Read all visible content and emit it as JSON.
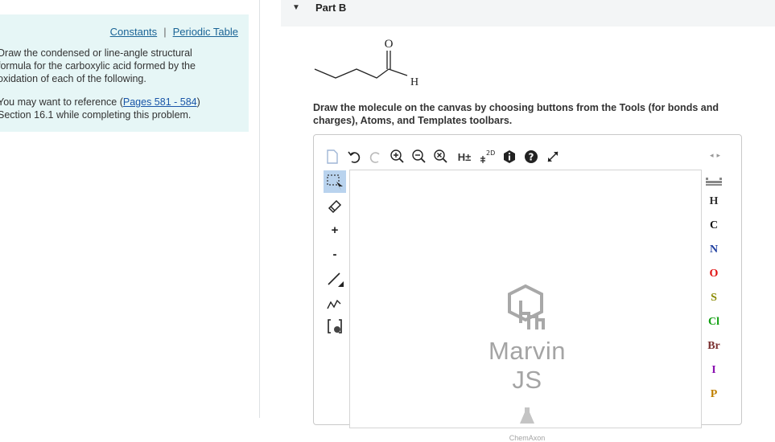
{
  "links": {
    "constants": "Constants",
    "separator": "|",
    "periodic_table": "Periodic Table"
  },
  "instructions": {
    "p1_l1": "Draw the condensed or line-angle structural",
    "p1_l2": "formula for the carboxylic acid formed by the",
    "p1_l3": "oxidation of each of the following.",
    "p2_l1_pre": "You may want to reference (",
    "p2_link": "Pages 581 - 584",
    "p2_l1_post": ")",
    "p2_l2": "Section 16.1 while completing this problem."
  },
  "part": {
    "caret": "▼",
    "title": "Part B"
  },
  "molecule": {
    "oxygen": "O",
    "hydrogen": "H"
  },
  "task_text": "Draw the molecule on the canvas by choosing buttons from the Tools (for bonds and charges), Atoms, and Templates toolbars.",
  "toolbar": {
    "h_toggle": "H±",
    "cleanup_2d": "2D",
    "nav_arrows": "◂▸"
  },
  "left_tools": {
    "plus": "+",
    "minus": "-"
  },
  "atoms": [
    {
      "symbol": "H",
      "color": "#333333"
    },
    {
      "symbol": "C",
      "color": "#111111"
    },
    {
      "symbol": "N",
      "color": "#1f3fa0"
    },
    {
      "symbol": "O",
      "color": "#e01010"
    },
    {
      "symbol": "S",
      "color": "#8a8a00"
    },
    {
      "symbol": "Cl",
      "color": "#10a010"
    },
    {
      "symbol": "Br",
      "color": "#7a3030"
    },
    {
      "symbol": "I",
      "color": "#8a10b0"
    },
    {
      "symbol": "P",
      "color": "#c08000"
    }
  ],
  "watermark": {
    "title": "Marvin JS",
    "subtitle": "ChemAxon"
  }
}
